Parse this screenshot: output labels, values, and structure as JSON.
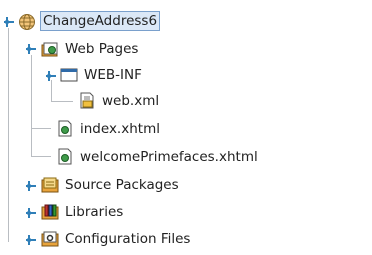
{
  "project_tree": {
    "root": {
      "label": "ChangeAddress6",
      "icon": "globe-icon",
      "expanded": true,
      "selected": true
    },
    "nodes": [
      {
        "label": "Web Pages",
        "icon": "web-folder-icon",
        "expanded": true
      },
      {
        "label": "WEB-INF",
        "icon": "folder-icon",
        "expanded": true
      },
      {
        "label": "web.xml",
        "icon": "xml-file-icon"
      },
      {
        "label": "index.xhtml",
        "icon": "xhtml-file-icon"
      },
      {
        "label": "welcomePrimefaces.xhtml",
        "icon": "xhtml-file-icon"
      },
      {
        "label": "Source Packages",
        "icon": "source-packages-icon",
        "expanded": false
      },
      {
        "label": "Libraries",
        "icon": "libraries-icon",
        "expanded": false
      },
      {
        "label": "Configuration Files",
        "icon": "configuration-files-icon",
        "expanded": false
      }
    ],
    "colors": {
      "tree_lines": "#b9bdc2",
      "selection_bg": "#dbe8f7",
      "selection_border": "#7aa0cc",
      "toggle": "#2f7fb8"
    }
  }
}
